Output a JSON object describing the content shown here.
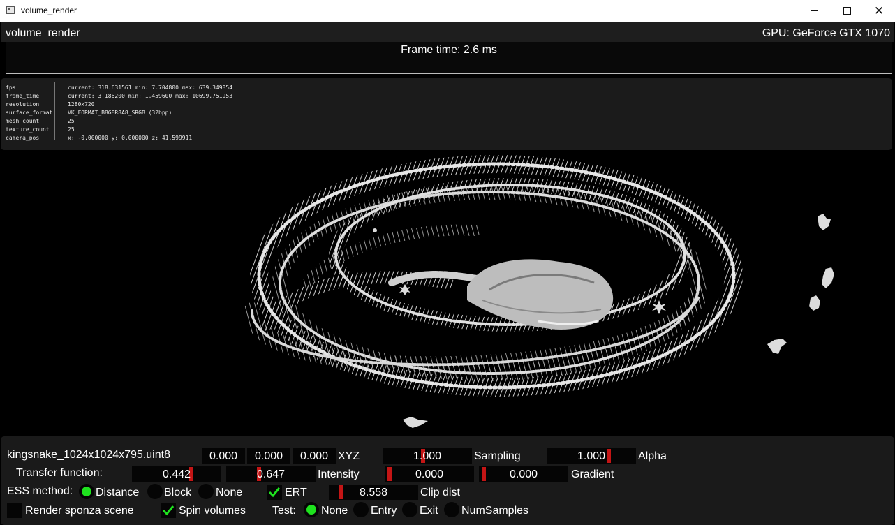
{
  "window": {
    "title": "volume_render",
    "controls": {
      "minimize_icon": "minimize-icon",
      "maximize_icon": "maximize-icon",
      "close_icon": "close-icon"
    }
  },
  "header": {
    "app_name": "volume_render",
    "gpu": "GPU: GeForce GTX 1070",
    "frame_time": "Frame time: 2.6 ms"
  },
  "stats": [
    {
      "key": "fps",
      "value": "current: 318.631561 min: 7.704800 max: 639.349854"
    },
    {
      "key": "frame_time",
      "value": "current: 3.186200 min: 1.459600 max: 10699.751953"
    },
    {
      "key": "resolution",
      "value": "1280x720"
    },
    {
      "key": "surface_format",
      "value": "VK_FORMAT_B8G8R8A8_SRGB (32bpp)"
    },
    {
      "key": "mesh_count",
      "value": "25"
    },
    {
      "key": "texture_count",
      "value": "25"
    },
    {
      "key": "camera_pos",
      "value": "x: -0.000000 y: 0.000000 z: 41.599911"
    }
  ],
  "controls": {
    "volume_file": "kingsnake_1024x1024x795.uint8",
    "xyz": {
      "x": "0.000",
      "y": "0.000",
      "z": "0.000",
      "label": "XYZ"
    },
    "sampling": {
      "value": "1.000",
      "label": "Sampling"
    },
    "alpha": {
      "value": "1.000",
      "label": "Alpha"
    },
    "transfer_function": {
      "label": "Transfer function:",
      "low": "0.442",
      "high": "0.647",
      "intensity_label": "Intensity",
      "gradient_low": "0.000",
      "gradient_high": "0.000",
      "gradient_label": "Gradient"
    },
    "ess": {
      "label": "ESS method:",
      "options": [
        "Distance",
        "Block",
        "None"
      ],
      "selected": "Distance"
    },
    "ert": {
      "label": "ERT",
      "checked": true
    },
    "clip_dist": {
      "value": "8.558",
      "label": "Clip dist"
    },
    "render_sponza": {
      "label": "Render sponza scene",
      "checked": false
    },
    "spin_volumes": {
      "label": "Spin volumes",
      "checked": true
    },
    "test": {
      "label": "Test:",
      "options": [
        "None",
        "Entry",
        "Exit",
        "NumSamples"
      ],
      "selected": "None"
    }
  },
  "colors": {
    "accent_radio": "#1ee21e",
    "slider_grab": "#c41515",
    "checkmark": "#1ee21e",
    "panel_bg": "#1a1a1a"
  }
}
